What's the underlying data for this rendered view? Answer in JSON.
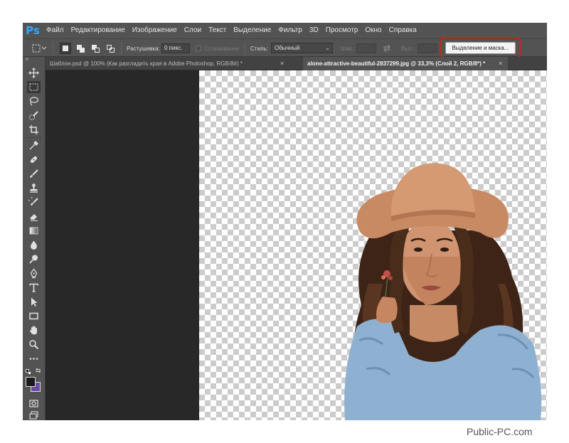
{
  "app": {
    "logo": "Ps"
  },
  "menu": [
    "Файл",
    "Редактирование",
    "Изображение",
    "Слои",
    "Текст",
    "Выделение",
    "Фильтр",
    "3D",
    "Просмотр",
    "Окно",
    "Справка"
  ],
  "options": {
    "feather_label": "Растушевка:",
    "feather_value": "0 пикс.",
    "antialias_label": "Сглаживание",
    "style_label": "Стиль:",
    "style_value": "Обычный",
    "width_label": "Шир.:",
    "height_label": "Выс.:",
    "select_mask_label": "Выделение и маска..."
  },
  "tabs": [
    {
      "title": "Шаблон.psd @ 100% (Как разгладить края в Adobe Photoshop, RGB/8#) *",
      "active": false
    },
    {
      "title": "alone-attractive-beautiful-2837299.jpg @ 33,3% (Слой 2, RGB/8*) *",
      "active": true
    }
  ],
  "tab_close": "×",
  "tools": [
    "move-icon",
    "rect-marquee-icon",
    "lasso-icon",
    "quick-select-icon",
    "crop-icon",
    "eyedropper-icon",
    "healing-brush-icon",
    "brush-icon",
    "clone-stamp-icon",
    "history-brush-icon",
    "eraser-icon",
    "gradient-icon",
    "blur-icon",
    "dodge-icon",
    "pen-icon",
    "type-icon",
    "path-select-icon",
    "rectangle-shape-icon",
    "hand-icon",
    "zoom-icon",
    "more-tools-icon"
  ],
  "colors": {
    "foreground": "#1a1a1a",
    "background": "#6f4aa5",
    "highlight": "#d91e18",
    "accent": "#31a8ff"
  },
  "watermark": "Public-PC.com"
}
